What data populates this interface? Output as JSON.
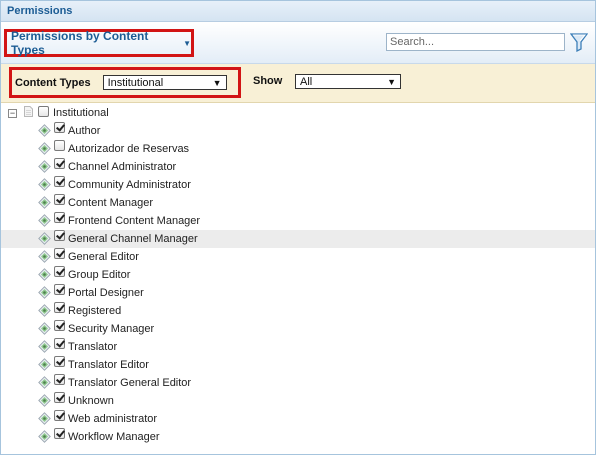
{
  "panel": {
    "title": "Permissions"
  },
  "toolbar": {
    "view_label": "Permissions by Content Types",
    "search_placeholder": "Search..."
  },
  "filters": {
    "content_types_label": "Content Types",
    "content_types_value": "Institutional",
    "show_label": "Show",
    "show_value": "All"
  },
  "tree": {
    "root": {
      "label": "Institutional",
      "checked": false
    },
    "roles": [
      {
        "label": "Author",
        "checked": true
      },
      {
        "label": "Autorizador de Reservas",
        "checked": false
      },
      {
        "label": "Channel Administrator",
        "checked": true
      },
      {
        "label": "Community Administrator",
        "checked": true
      },
      {
        "label": "Content Manager",
        "checked": true
      },
      {
        "label": "Frontend Content Manager",
        "checked": true
      },
      {
        "label": "General Channel Manager",
        "checked": true,
        "highlighted": true
      },
      {
        "label": "General Editor",
        "checked": true
      },
      {
        "label": "Group Editor",
        "checked": true
      },
      {
        "label": "Portal Designer",
        "checked": true
      },
      {
        "label": "Registered",
        "checked": true
      },
      {
        "label": "Security Manager",
        "checked": true
      },
      {
        "label": "Translator",
        "checked": true
      },
      {
        "label": "Translator Editor",
        "checked": true
      },
      {
        "label": "Translator General Editor",
        "checked": true
      },
      {
        "label": "Unknown",
        "checked": true
      },
      {
        "label": "Web administrator",
        "checked": true
      },
      {
        "label": "Workflow Manager",
        "checked": true
      }
    ]
  },
  "colors": {
    "accent": "#1c5c94",
    "highlight_border": "#d21414",
    "filter_bar_bg": "#f8f0d6"
  },
  "icons": {
    "role": "role-diamond-icon",
    "root_doc": "document-icon",
    "filter": "filter-funnel-icon",
    "expander": "collapse-minus-icon"
  }
}
